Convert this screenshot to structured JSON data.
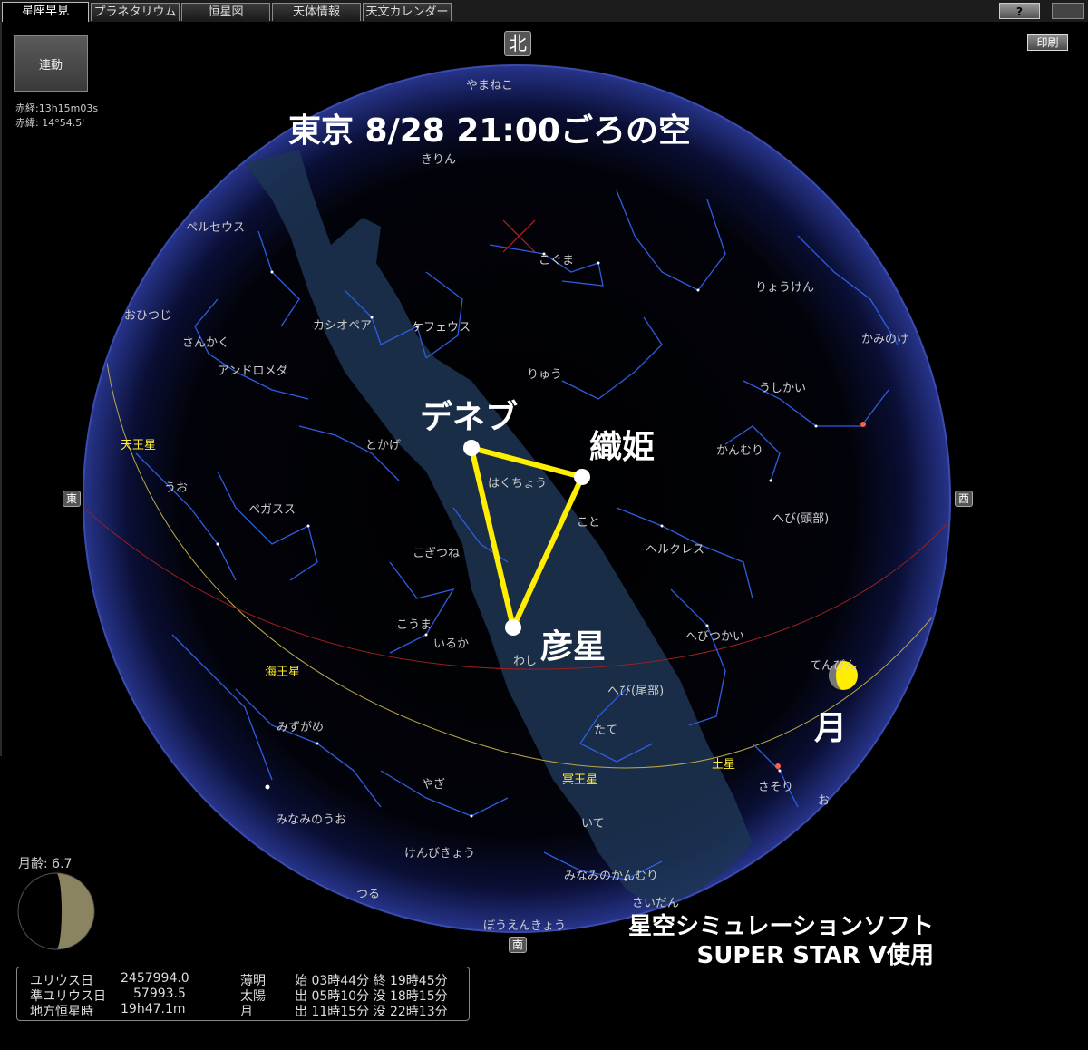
{
  "tabs": [
    "星座早見",
    "プラネタリウム",
    "恒星図",
    "天体情報",
    "天文カレンダー"
  ],
  "help_label": "?",
  "link_button": "連動",
  "coords": {
    "ra": "赤経:13h15m03s",
    "dec": "赤緯: 14°54.5'"
  },
  "print_label": "印刷",
  "directions": {
    "north": "北",
    "south": "南",
    "east": "東",
    "west": "西"
  },
  "title": "東京 8/28 21:00ごろの空",
  "triangle": {
    "deneb": "デネブ",
    "vega": "織姫",
    "altair": "彦星",
    "moon": "月"
  },
  "constellations": [
    {
      "name": "やまねこ"
    },
    {
      "name": "きりん"
    },
    {
      "name": "こぐま"
    },
    {
      "name": "ペルセウス"
    },
    {
      "name": "りょうけん"
    },
    {
      "name": "おひつじ"
    },
    {
      "name": "カシオペア"
    },
    {
      "name": "ケフェウス"
    },
    {
      "name": "かみのけ"
    },
    {
      "name": "さんかく"
    },
    {
      "name": "アンドロメダ"
    },
    {
      "name": "りゅう"
    },
    {
      "name": "うしかい"
    },
    {
      "name": "天王星",
      "planet": true
    },
    {
      "name": "とかげ"
    },
    {
      "name": "かんむり"
    },
    {
      "name": "はくちょう"
    },
    {
      "name": "うお"
    },
    {
      "name": "ペガスス"
    },
    {
      "name": "へび(頭部)"
    },
    {
      "name": "こと"
    },
    {
      "name": "ヘルクレス"
    },
    {
      "name": "こぎつね"
    },
    {
      "name": "こうま"
    },
    {
      "name": "へびつかい"
    },
    {
      "name": "いるか"
    },
    {
      "name": "わし"
    },
    {
      "name": "てんびん"
    },
    {
      "name": "海王星",
      "planet": true
    },
    {
      "name": "へび(尾部)"
    },
    {
      "name": "みずがめ"
    },
    {
      "name": "たて"
    },
    {
      "name": "土星",
      "planet": true
    },
    {
      "name": "冥王星",
      "planet": true
    },
    {
      "name": "さそり"
    },
    {
      "name": "やぎ"
    },
    {
      "name": "みなみのうお"
    },
    {
      "name": "いて"
    },
    {
      "name": "けんびきょう"
    },
    {
      "name": "みなみのかんむり"
    },
    {
      "name": "つる"
    },
    {
      "name": "さいだん"
    },
    {
      "name": "ぼうえんきょう"
    },
    {
      "name": "お"
    }
  ],
  "credit": {
    "line1": "星空シミュレーションソフト",
    "line2": "SUPER STAR V使用"
  },
  "moon_age": "月齢: 6.7",
  "info": {
    "rows": [
      {
        "label": "ユリウス日",
        "value": "2457994.0",
        "event": "薄明",
        "times": "始 03時44分  終 19時45分"
      },
      {
        "label": "準ユリウス日",
        "value": "57993.5",
        "event": "太陽",
        "times": "出 05時10分  没 18時15分"
      },
      {
        "label": "地方恒星時",
        "value": "19h47.1m",
        "event": "月",
        "times": "出 11時15分  没 22時13分"
      }
    ]
  },
  "colors": {
    "triangle": "#ffee00",
    "milkyway": "#1f3a5a",
    "lines": "#2f5de0",
    "horizon": "#1b2f7a"
  }
}
